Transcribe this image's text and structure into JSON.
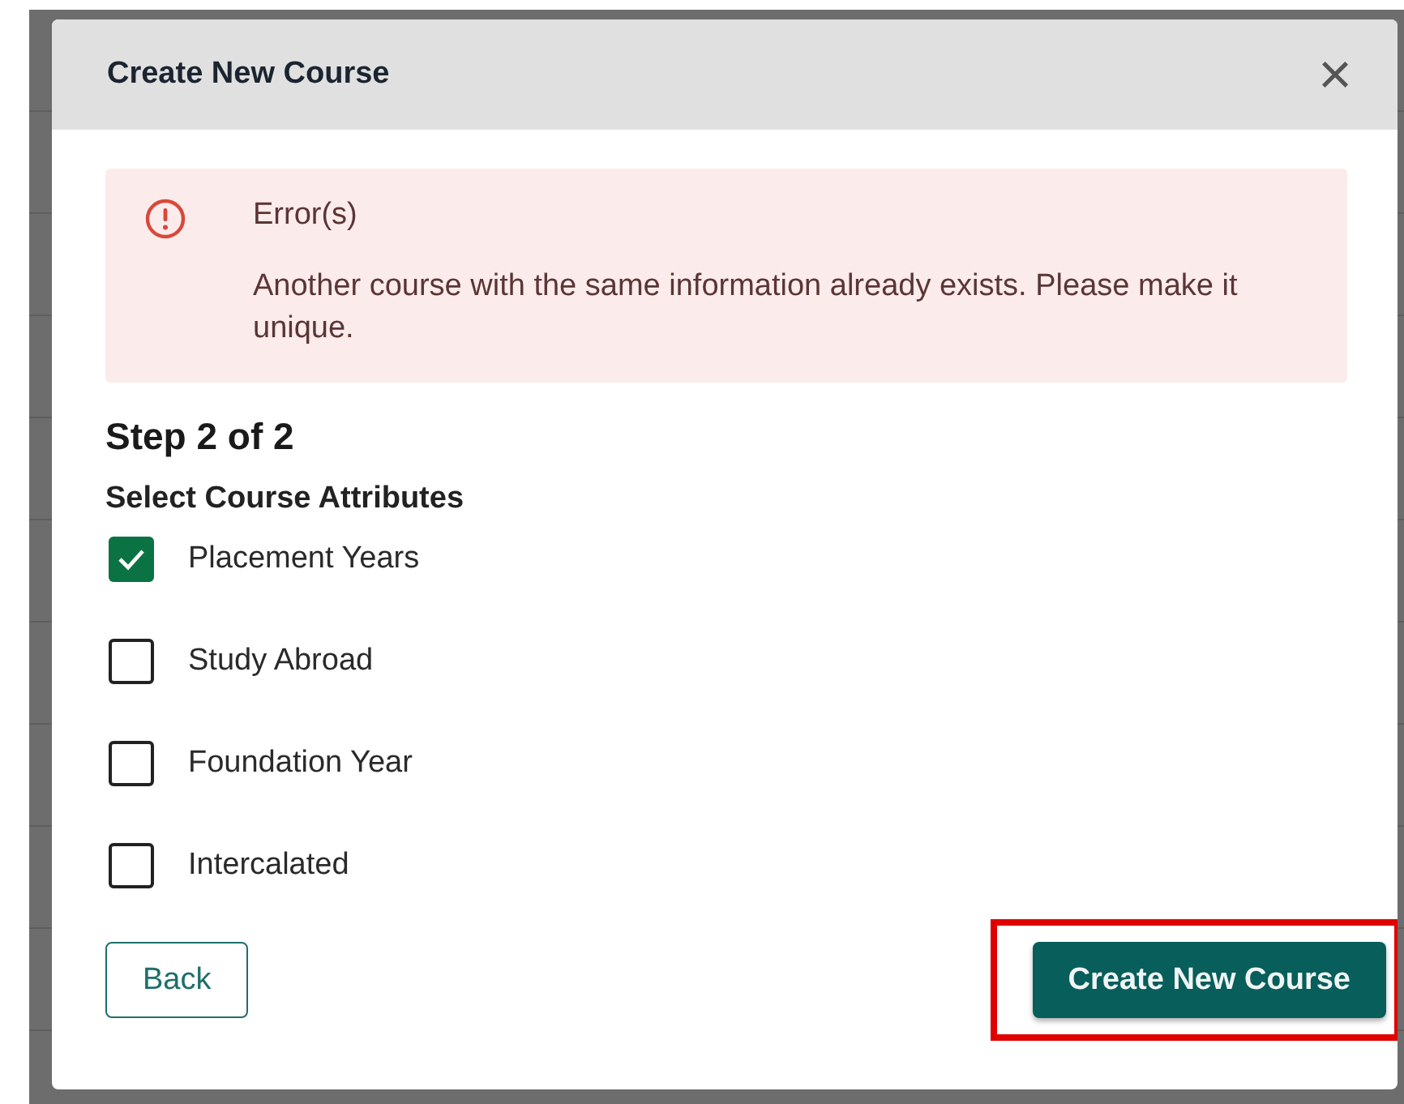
{
  "dialog": {
    "title": "Create New Course",
    "close_label": "×"
  },
  "error": {
    "title": "Error(s)",
    "message": "Another course with the same information already exists. Please make it unique."
  },
  "step": "Step 2 of 2",
  "section_label": "Select Course Attributes",
  "attributes": [
    {
      "label": "Placement Years",
      "checked": true
    },
    {
      "label": "Study Abroad",
      "checked": false
    },
    {
      "label": "Foundation Year",
      "checked": false
    },
    {
      "label": "Intercalated",
      "checked": false
    }
  ],
  "buttons": [
    {
      "label": "Back",
      "kind": "secondary",
      "highlighted": false
    },
    {
      "label": "Create New Course",
      "kind": "primary",
      "highlighted": true
    }
  ]
}
